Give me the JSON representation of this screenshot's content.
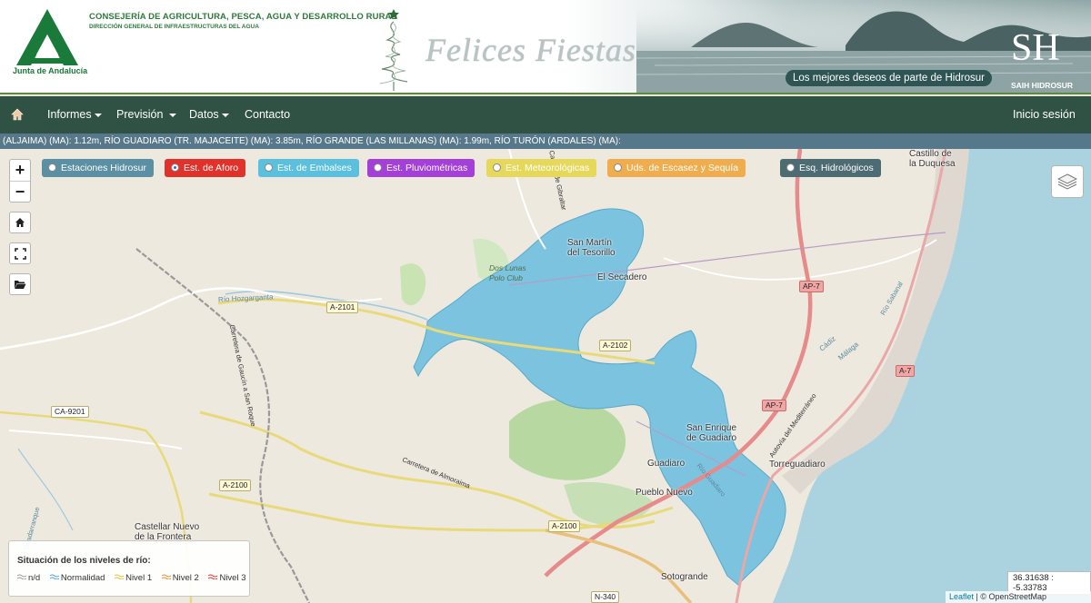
{
  "header": {
    "brand_name": "Junta de Andalucía",
    "ministry": "CONSEJERÍA DE AGRICULTURA, PESCA, AGUA Y DESARROLLO RURAL",
    "direction": "DIRECCIÓN GENERAL DE INFRAESTRUCTURAS DEL AGUA",
    "greeting_banner": "Felices Fiestas",
    "wishes": "Los mejores deseos de parte de Hidrosur",
    "system_logo": "SH",
    "system_name": "SAIH HIDROSUR"
  },
  "navbar": {
    "home_icon": "home-icon",
    "items": [
      {
        "label": "Informes",
        "dropdown": true
      },
      {
        "label": "Previsión",
        "dropdown": true
      },
      {
        "label": "Datos",
        "dropdown": true
      },
      {
        "label": "Contacto",
        "dropdown": false
      }
    ],
    "login": "Inicio sesión"
  },
  "ticker": {
    "text": "(ALJAIMA) (MA): 1.12m, RÍO GUADIARO (TR. MAJACEITE) (MA): 3.85m, RÍO GRANDE (LAS MILLANAS) (MA): 1.99m, RÍO TURÓN (ARDALES) (MA):"
  },
  "map": {
    "controls": {
      "zoom_in": "+",
      "zoom_out": "−",
      "home_icon": "home-icon",
      "fullscreen_icon": "fullscreen-icon",
      "folder_icon": "folder-open-icon",
      "layers_icon": "layers-icon"
    },
    "layer_buttons": [
      {
        "label": "Estaciones Hidrosur",
        "color": "#5b8fa3",
        "selected": false
      },
      {
        "label": "Est. de Aforo",
        "color": "#e0322a",
        "selected": true
      },
      {
        "label": "Est. de Embalses",
        "color": "#5bc0de",
        "selected": false
      },
      {
        "label": "Est. Pluviométricas",
        "color": "#a43fd8",
        "selected": false
      },
      {
        "label": "Est. Meteorológicas",
        "color": "#e6d85b",
        "selected": false
      },
      {
        "label": "Uds. de Escasez y Sequía",
        "color": "#f0ad4e",
        "selected": false
      },
      {
        "label": "Esq. Hidrológicos",
        "color": "#4d6b73",
        "selected": false
      }
    ],
    "labels": {
      "castillo": "Castillo de\nla Duquesa",
      "san_martin": "San Martín\ndel Tesorillo",
      "el_secadero": "El Secadero",
      "dos_lunas": "Dos Lunas\nPolo Club",
      "san_enrique": "San Enrique\nde Guadiaro",
      "guadiaro": "Guadiaro",
      "torreguadiaro": "Torreguadiaro",
      "pueblo_nuevo": "Pueblo Nuevo",
      "sotogrande": "Sotogrande",
      "castellar": "Castellar Nuevo\nde la Frontera",
      "rio_hozgarganta": "Río Hozgarganta",
      "carretera_gaucin": "Carretera de Gaucín a San Roque",
      "carretera_almoraima": "Carretera de Almoraima",
      "rio_guadarranque": "Río Guadarranque",
      "camino_gibraltar": "Camino de Gibraltar",
      "rio_guadiaro": "Río Guadiaro",
      "malaga": "Málaga",
      "cadiz": "Cádiz",
      "autovia": "Autovía del Mediterráneo",
      "rio_sabanal": "Río Sabanal"
    },
    "roads": [
      "A-2101",
      "A-2102",
      "A-2100",
      "A-2100",
      "AP-7",
      "AP-7",
      "A-7",
      "CA-9201",
      "N-340"
    ],
    "legend": {
      "title": "Situación de los niveles de río:",
      "items": [
        {
          "label": "n/d",
          "color": "#9a9a9a"
        },
        {
          "label": "Normalidad",
          "color": "#4aa3df"
        },
        {
          "label": "Nivel 1",
          "color": "#e6c23a"
        },
        {
          "label": "Nivel 2",
          "color": "#f08a2c"
        },
        {
          "label": "Nivel 3",
          "color": "#e0322a"
        }
      ]
    },
    "coordinates": "36.31638 : -5.33783",
    "attribution_link": "Leaflet",
    "attribution_text": " | © OpenStreetMap contributors"
  }
}
